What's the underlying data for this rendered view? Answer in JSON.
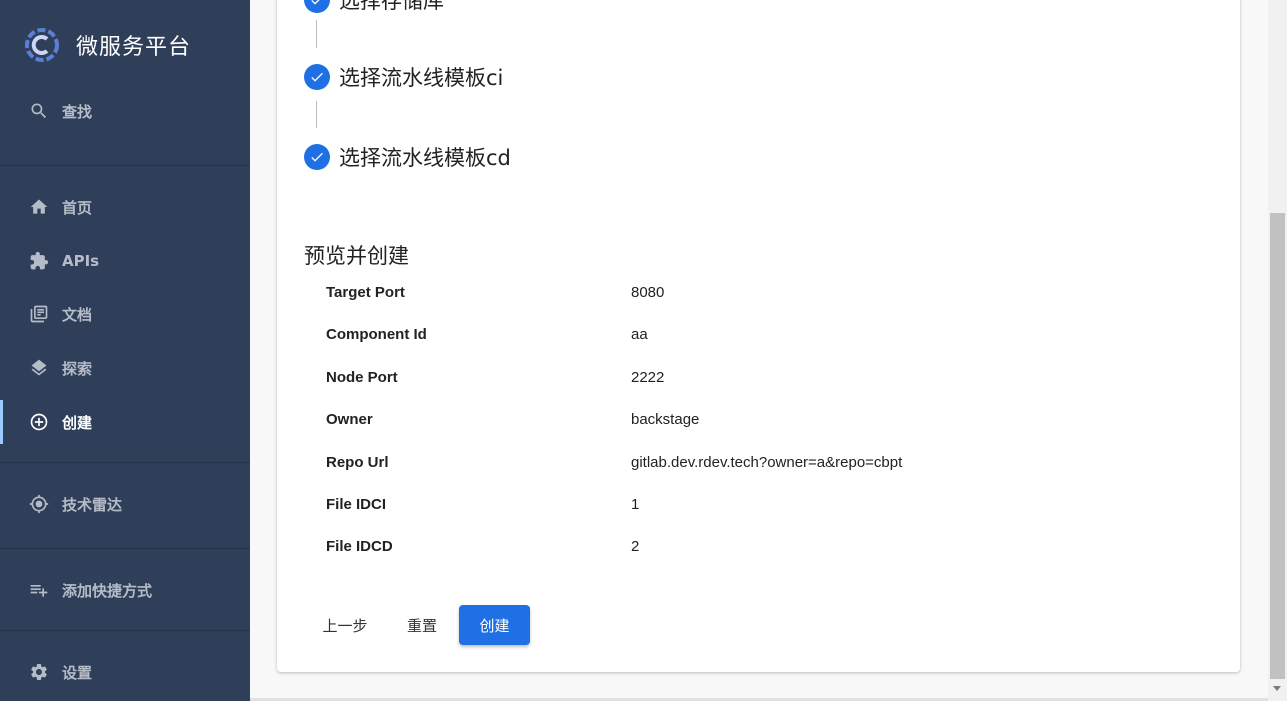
{
  "app": {
    "title": "微服务平台"
  },
  "sidebar": {
    "search_label": "查找",
    "items": [
      {
        "label": "首页",
        "icon": "home-icon"
      },
      {
        "label": "APIs",
        "icon": "puzzle-icon"
      },
      {
        "label": "文档",
        "icon": "library-books-icon"
      },
      {
        "label": "探索",
        "icon": "layers-icon"
      },
      {
        "label": "创建",
        "icon": "add-circle-icon",
        "active": true
      },
      {
        "label": "技术雷达",
        "icon": "radar-icon"
      },
      {
        "label": "添加快捷方式",
        "icon": "playlist-add-icon"
      },
      {
        "label": "设置",
        "icon": "gear-icon"
      }
    ]
  },
  "steps": [
    {
      "label": "选择存储库"
    },
    {
      "label": "选择流水线模板ci"
    },
    {
      "label": "选择流水线模板cd"
    }
  ],
  "review": {
    "title": "预览并创建",
    "rows": [
      {
        "key": "Target Port",
        "value": "8080"
      },
      {
        "key": "Component Id",
        "value": "aa"
      },
      {
        "key": "Node Port",
        "value": "2222"
      },
      {
        "key": "Owner",
        "value": "backstage"
      },
      {
        "key": "Repo Url",
        "value": "gitlab.dev.rdev.tech?owner=a&repo=cbpt"
      },
      {
        "key": "File IDCI",
        "value": "1"
      },
      {
        "key": "File IDCD",
        "value": "2"
      }
    ]
  },
  "actions": {
    "back_label": "上一步",
    "reset_label": "重置",
    "create_label": "创建"
  },
  "colors": {
    "sidebar_bg": "#2f3f5a",
    "accent": "#1f6fe5"
  }
}
